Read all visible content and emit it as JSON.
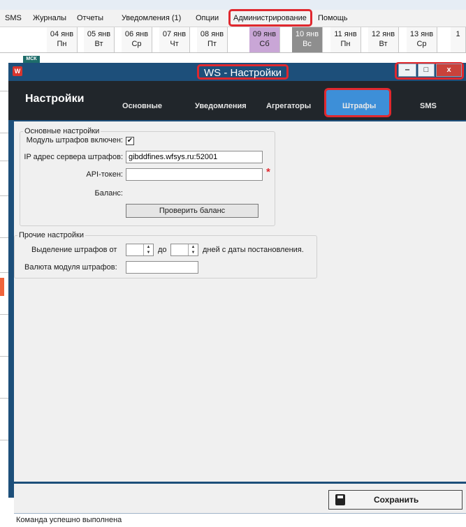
{
  "menubar": {
    "items": [
      "SMS",
      "Журналы",
      "Отчеты",
      "Уведомления (1)",
      "Опции",
      "Администрирование",
      "Помощь"
    ]
  },
  "calendar": {
    "days": [
      {
        "date": "04 янв",
        "weekday": "Пн"
      },
      {
        "date": "05 янв",
        "weekday": "Вт"
      },
      {
        "date": "06 янв",
        "weekday": "Ср"
      },
      {
        "date": "07 янв",
        "weekday": "Чт"
      },
      {
        "date": "08 янв",
        "weekday": "Пт"
      },
      {
        "date": "09 янв",
        "weekday": "Сб"
      },
      {
        "date": "10 янв",
        "weekday": "Вс"
      },
      {
        "date": "11 янв",
        "weekday": "Пн"
      },
      {
        "date": "12 янв",
        "weekday": "Вт"
      },
      {
        "date": "13 янв",
        "weekday": "Ср"
      },
      {
        "date": "1",
        "weekday": ""
      }
    ],
    "timezone_badge": "МСК"
  },
  "dialog": {
    "window_title": "WS - Настройки",
    "window_buttons": {
      "minimize": "‒",
      "maximize": "□",
      "close": "x"
    },
    "header_title": "Настройки",
    "tabs": [
      "Основные",
      "Уведомления",
      "Агрегаторы",
      "Штрафы",
      "SMS"
    ],
    "active_tab": "Штрафы",
    "main_settings": {
      "legend": "Основные настройки",
      "module_enabled_label": "Модуль штрафов включен:",
      "module_enabled_checked": true,
      "module_enabled_mark": "✔",
      "server_ip_label": "IP адрес сервера штрафов:",
      "server_ip_value": "gibddfines.wfsys.ru:52001",
      "api_token_label": "API-токен:",
      "api_token_value": "",
      "required_mark": "*",
      "balance_label": "Баланс:",
      "check_balance_button": "Проверить баланс"
    },
    "other_settings": {
      "legend": "Прочие настройки",
      "highlight_from_label": "Выделение штрафов от",
      "highlight_from_value": "",
      "to_label": "до",
      "to_value": "",
      "days_suffix": "дней с даты постановления.",
      "currency_label": "Валюта модуля штрафов:",
      "currency_value": ""
    },
    "save_button": "Сохранить",
    "status_text": "Команда успешно выполнена"
  },
  "colors": {
    "highlight_red": "#e0282e",
    "dialog_blue": "#1d4f7a",
    "header_dark": "#21262b",
    "active_tab_blue": "#3d8fd8",
    "saturday": "#c9a6d6",
    "sunday": "#8e8e8e"
  }
}
